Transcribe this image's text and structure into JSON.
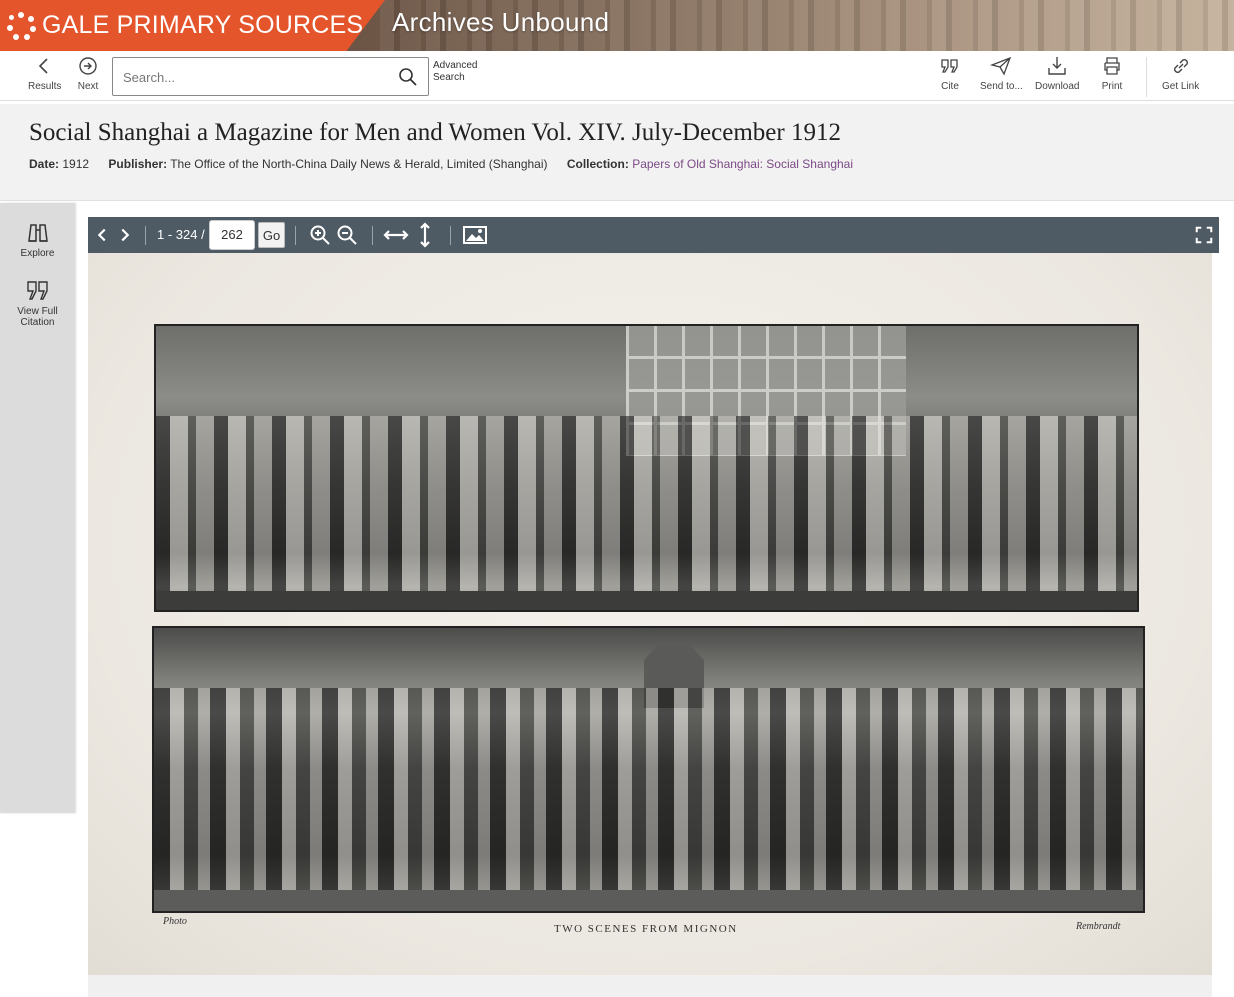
{
  "banner": {
    "brand": "GALE PRIMARY SOURCES",
    "product": "Archives Unbound",
    "brand_color": "#e4552c"
  },
  "toolbar": {
    "results_label": "Results",
    "next_label": "Next",
    "search_placeholder": "Search...",
    "advanced_line1": "Advanced",
    "advanced_line2": "Search",
    "cite_label": "Cite",
    "send_label": "Send to...",
    "download_label": "Download",
    "print_label": "Print",
    "getlink_label": "Get Link"
  },
  "document": {
    "title": "Social Shanghai a Magazine for Men and Women Vol. XIV. July-December 1912",
    "date_label": "Date:",
    "date": "1912",
    "publisher_label": "Publisher:",
    "publisher": "The Office of the North-China Daily News & Herald, Limited (Shanghai)",
    "collection_label": "Collection:",
    "collection": "Papers of Old Shanghai: Social Shanghai"
  },
  "sidetools": {
    "explore_label": "Explore",
    "citation_line1": "View Full",
    "citation_line2": "Citation"
  },
  "viewer": {
    "page_range": "1 - 324 /",
    "current_page": "262",
    "go_label": "Go"
  },
  "page": {
    "caption_left": "Photo",
    "caption_center": "TWO SCENES FROM MIGNON",
    "caption_right": "Rembrandt"
  }
}
